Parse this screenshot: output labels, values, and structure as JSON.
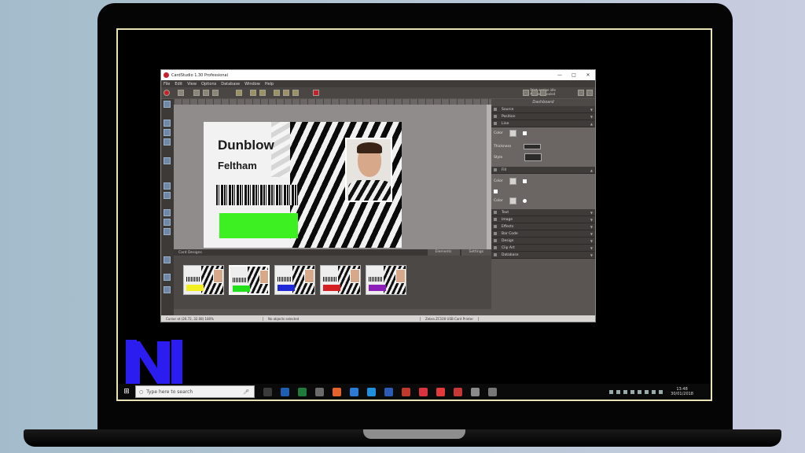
{
  "window": {
    "title": "CardStudio 1.30 Professional",
    "controls": [
      "—",
      "□",
      "✕"
    ]
  },
  "menu": [
    "File",
    "Edit",
    "View",
    "Options",
    "Database",
    "Window",
    "Help"
  ],
  "toolbar_status": [
    "Print engine idle",
    "No jobs spooled"
  ],
  "card": {
    "name": "Dunblow",
    "location": "Feltham",
    "bar_color": "#3cf021"
  },
  "panel": {
    "label": "Card Designs",
    "tabs": [
      "Elements",
      "Settings"
    ]
  },
  "thumbnails": [
    {
      "color": "#f2ee20",
      "selected": false
    },
    {
      "color": "#22e01c",
      "selected": true
    },
    {
      "color": "#1f2ad6",
      "selected": false
    },
    {
      "color": "#d61f23",
      "selected": false
    },
    {
      "color": "#8c1fb8",
      "selected": false
    }
  ],
  "statusbar": [
    "Cursor at (26.72, 32.08) 180%",
    "No objects selected",
    "Zebra ZC100 USB Card Printer"
  ],
  "dashboard": {
    "title": "Dashboard",
    "sections_top": [
      "Source",
      "Position",
      "Line"
    ],
    "line_labels": {
      "color": "Color",
      "thickness": "Thickness",
      "style": "Style"
    },
    "fill_section": "Fill",
    "fill_labels": {
      "color1": "Color",
      "color2": "Color"
    },
    "sections_bottom": [
      "Text",
      "Image",
      "Effects",
      "Bar Code",
      "Design",
      "Clip Art",
      "Database"
    ]
  },
  "taskbar": {
    "search_placeholder": "Type here to search",
    "clock_time": "13:48",
    "clock_date": "30/01/2018",
    "apps": [
      "#3a3a3a",
      "#1e5fb4",
      "#1f7a3c",
      "#6b6b6b",
      "#e5632a",
      "#2a7ad6",
      "#1f8fe0",
      "#2c5bb5",
      "#c0392b",
      "#d9333f",
      "#e23a3a",
      "#c83737",
      "#8a8a8a",
      "#777777"
    ]
  }
}
